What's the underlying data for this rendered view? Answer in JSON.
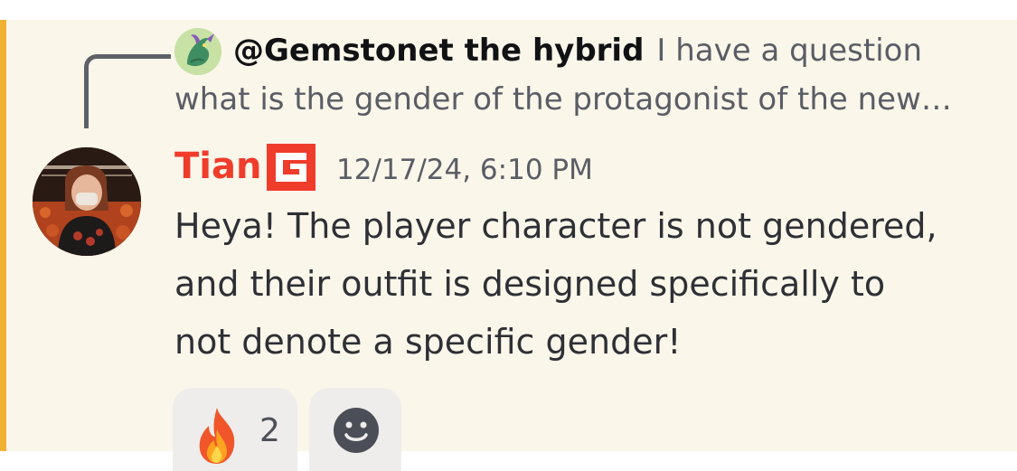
{
  "reply": {
    "author": "@Gemstonet the hybrid",
    "text_line1": "I have a question",
    "text_line2": "what is the gender of the protagonist of the new…",
    "avatar_icon": "dragon-avatar-icon"
  },
  "message": {
    "author": "Tian",
    "author_color": "#ef3c2b",
    "role_badge_icon": "g-logo-badge-icon",
    "timestamp": "12/17/24, 6:10 PM",
    "lines": [
      "Heya! The player character is not gendered,",
      "and their outfit is designed specifically to",
      "not denote a specific gender!"
    ],
    "highlight_color": "#f0b132"
  },
  "reactions": [
    {
      "emoji": "fire-icon",
      "count": "2"
    }
  ],
  "add_reaction_icon": "smiley-add-reaction-icon"
}
